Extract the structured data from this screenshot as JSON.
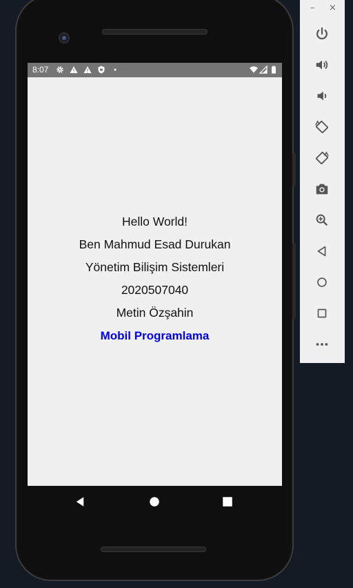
{
  "status_bar": {
    "time": "8:07",
    "left_icons": [
      "gear-icon",
      "warning-icon",
      "warning-icon",
      "shield-icon",
      "dot-icon"
    ],
    "right_icons": [
      "wifi-icon",
      "signal-icon",
      "battery-icon"
    ],
    "background": "#757575"
  },
  "app": {
    "background": "#f0f0f0",
    "lines": [
      {
        "text": "Hello World!",
        "color": "#111111"
      },
      {
        "text": "Ben Mahmud Esad Durukan",
        "color": "#111111"
      },
      {
        "text": "Yönetim Bilişim Sistemleri",
        "color": "#111111"
      },
      {
        "text": "2020507040",
        "color": "#111111"
      },
      {
        "text": "Metin Özşahin",
        "color": "#111111"
      },
      {
        "text": "Mobil Programlama",
        "color": "#0000ee"
      }
    ]
  },
  "nav_bar": {
    "buttons": [
      "back-icon",
      "home-icon",
      "recents-icon"
    ]
  },
  "emulator_panel": {
    "window_controls": {
      "minimize": "–",
      "close": "×"
    },
    "tools": [
      "power-icon",
      "volume-up-icon",
      "volume-down-icon",
      "rotate-left-icon",
      "rotate-right-icon",
      "camera-icon",
      "zoom-icon",
      "back-icon",
      "home-icon",
      "overview-icon",
      "more-icon"
    ]
  }
}
